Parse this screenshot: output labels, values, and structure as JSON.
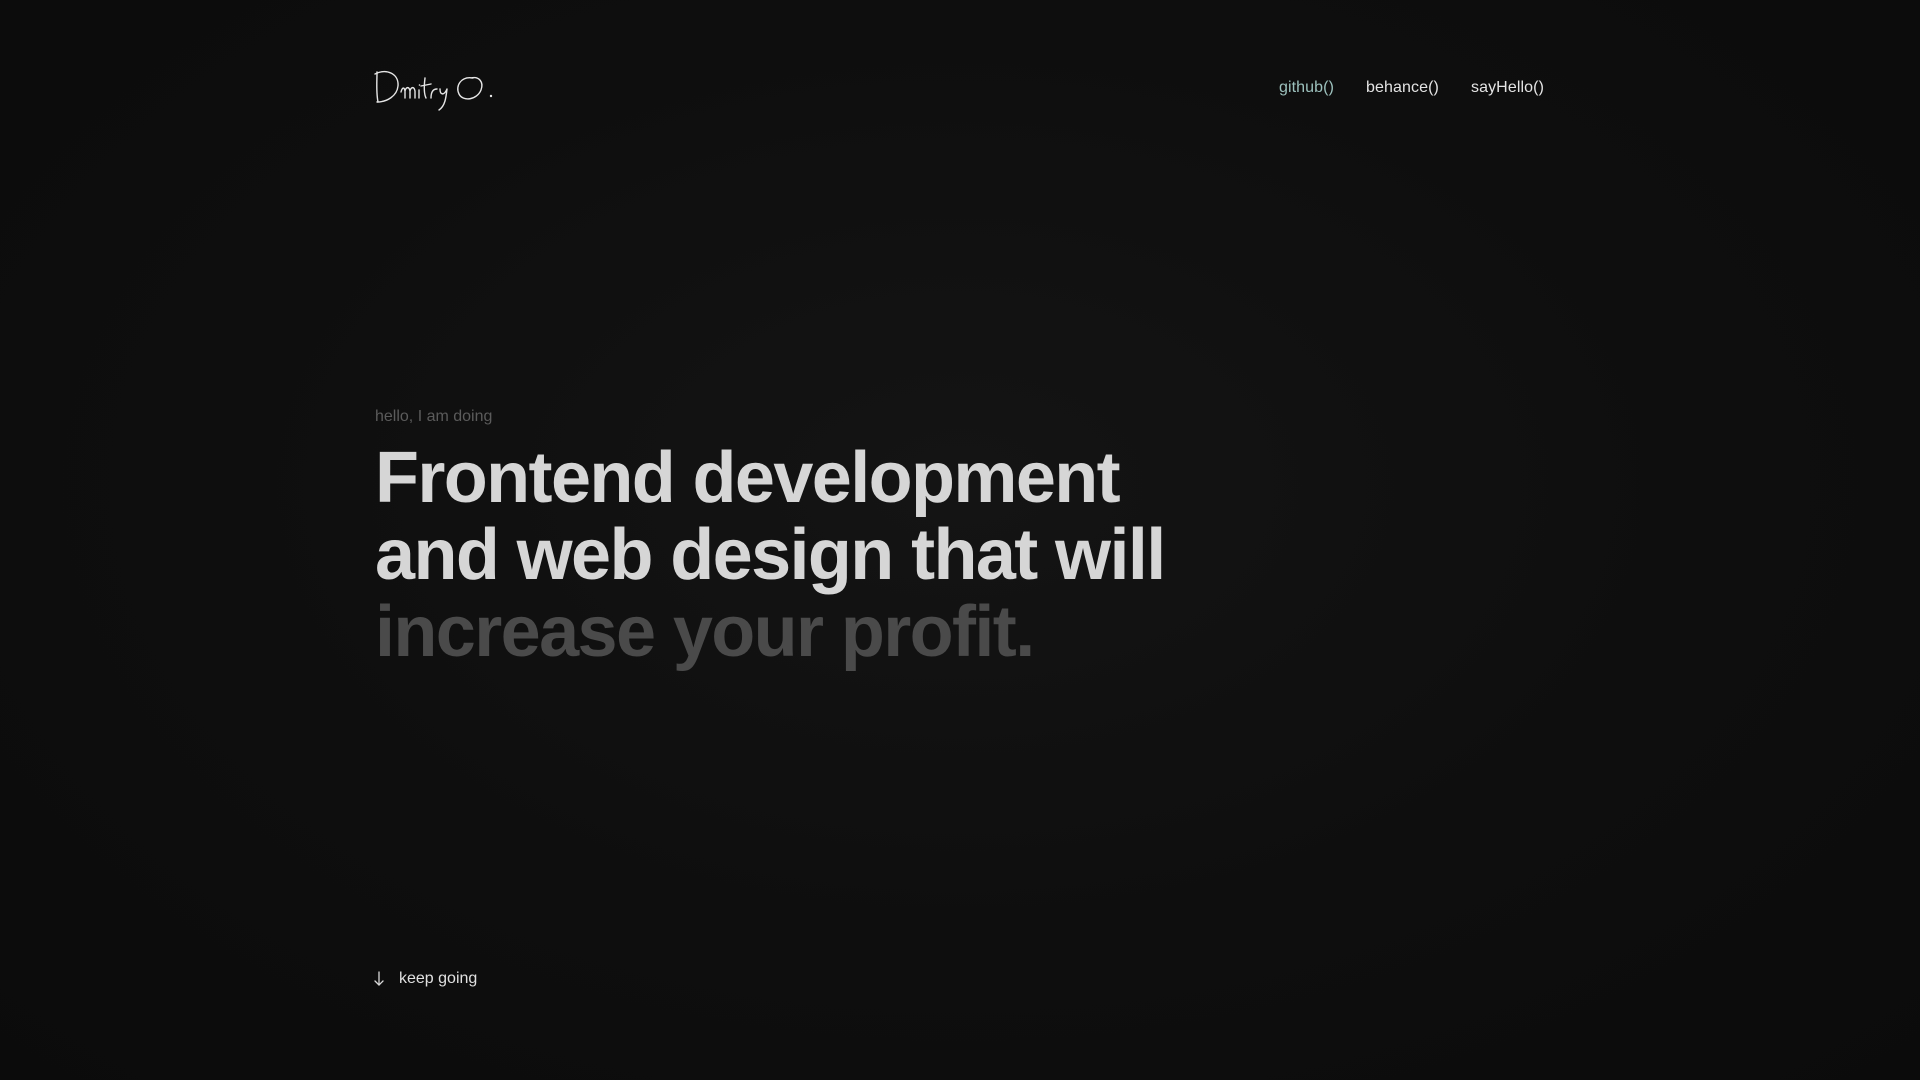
{
  "header": {
    "logo_text": "Dmitry O.",
    "nav": [
      {
        "label": "github()",
        "active": true
      },
      {
        "label": "behance()",
        "active": false
      },
      {
        "label": "sayHello()",
        "active": false
      }
    ]
  },
  "hero": {
    "eyebrow": "hello, I am doing",
    "headline_line_1": "Frontend development",
    "headline_line_2": "and web design that will",
    "headline_line_3": "increase your profit."
  },
  "scroll_hint": {
    "icon": "arrow-down-icon",
    "label": "keep going"
  },
  "colors": {
    "background": "#0d0d0d",
    "text_primary": "#d6d6d6",
    "text_muted": "#4a4a4a",
    "nav_active": "#9cc1bd"
  }
}
